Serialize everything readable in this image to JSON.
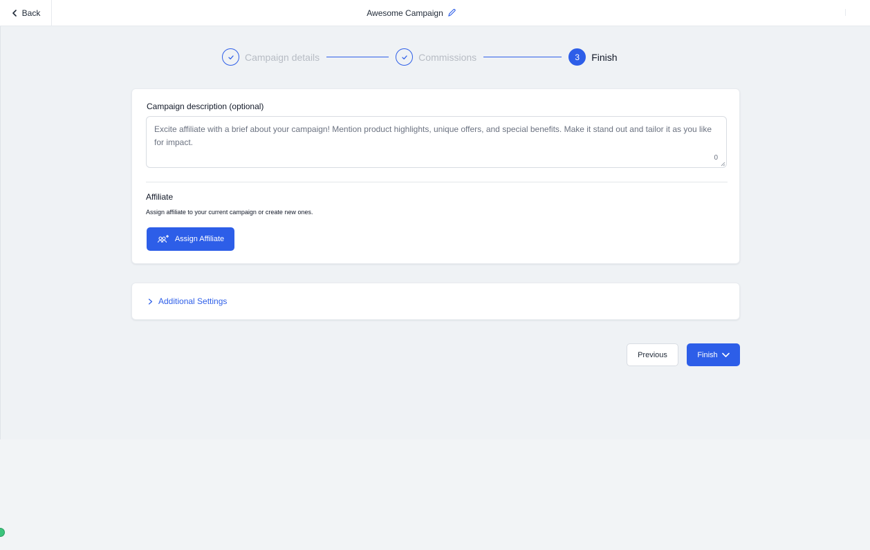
{
  "header": {
    "back_label": "Back",
    "campaign_title": "Awesome Campaign"
  },
  "stepper": {
    "steps": [
      {
        "label": "Campaign details",
        "state": "complete"
      },
      {
        "label": "Commissions",
        "state": "complete"
      },
      {
        "number": "3",
        "label": "Finish",
        "state": "active"
      }
    ]
  },
  "description": {
    "label": "Campaign description (optional)",
    "placeholder": "Excite affiliate with a brief about your campaign! Mention product highlights, unique offers, and special benefits. Make it stand out and tailor it as you like for impact.",
    "value": "",
    "char_count": "0"
  },
  "affiliate": {
    "title": "Affiliate",
    "subtitle": "Assign affiliate to your current campaign or create new ones.",
    "assign_label": "Assign Affiliate"
  },
  "settings": {
    "toggle_label": "Additional Settings"
  },
  "footer": {
    "previous_label": "Previous",
    "finish_label": "Finish"
  },
  "colors": {
    "accent": "#2d5ee8",
    "background": "#eff2f5",
    "muted_text": "#b7bcc4",
    "status_dot": "#3cc47c"
  }
}
